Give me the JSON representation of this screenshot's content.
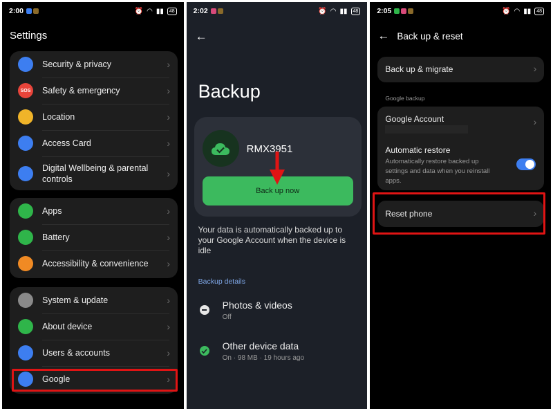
{
  "screen1": {
    "time": "2:00",
    "battery": "48",
    "title": "Settings",
    "groups": [
      [
        {
          "label": "Security & privacy",
          "icon": "lock-icon",
          "color": "#3d7ef0"
        },
        {
          "label": "Safety & emergency",
          "icon": "sos-icon",
          "icon_text": "SOS",
          "color": "#e8443a"
        },
        {
          "label": "Location",
          "icon": "location-pin-icon",
          "color": "#f0b429"
        },
        {
          "label": "Access Card",
          "icon": "card-icon",
          "color": "#3d7ef0"
        },
        {
          "label": "Digital Wellbeing & parental controls",
          "icon": "wellbeing-icon",
          "color": "#3d7ef0"
        }
      ],
      [
        {
          "label": "Apps",
          "icon": "apps-grid-icon",
          "color": "#2fb54a"
        },
        {
          "label": "Battery",
          "icon": "battery-icon",
          "color": "#2fb54a"
        },
        {
          "label": "Accessibility & convenience",
          "icon": "accessibility-icon",
          "color": "#f08a24"
        }
      ],
      [
        {
          "label": "System & update",
          "icon": "gear-icon",
          "color": "#8a8a8a"
        },
        {
          "label": "About device",
          "icon": "phone-icon",
          "color": "#2fb54a"
        },
        {
          "label": "Users & accounts",
          "icon": "user-icon",
          "color": "#3d7ef0"
        },
        {
          "label": "Google",
          "icon": "google-icon",
          "color": "#3d7ef0"
        }
      ]
    ]
  },
  "screen2": {
    "time": "2:02",
    "battery": "48",
    "title": "Backup",
    "device_name": "RMX3951",
    "backup_button": "Back up now",
    "description": "Your data is automatically backed up to your Google Account when the device is idle",
    "section_header": "Backup details",
    "details": [
      {
        "title": "Photos & videos",
        "subtitle": "Off",
        "icon": "minus-circle-icon"
      },
      {
        "title": "Other device data",
        "subtitle": "On · 98 MB · 19 hours ago",
        "icon": "check-circle-icon"
      }
    ],
    "accent": "#3cba5e"
  },
  "screen3": {
    "time": "2:05",
    "battery": "48",
    "title": "Back up & reset",
    "back_up_migrate": "Back up & migrate",
    "google_backup_header": "Google backup",
    "google_account": "Google Account",
    "auto_restore_title": "Automatic restore",
    "auto_restore_desc": "Automatically restore backed up settings and data when you reinstall apps.",
    "auto_restore_on": true,
    "reset_phone": "Reset phone"
  }
}
